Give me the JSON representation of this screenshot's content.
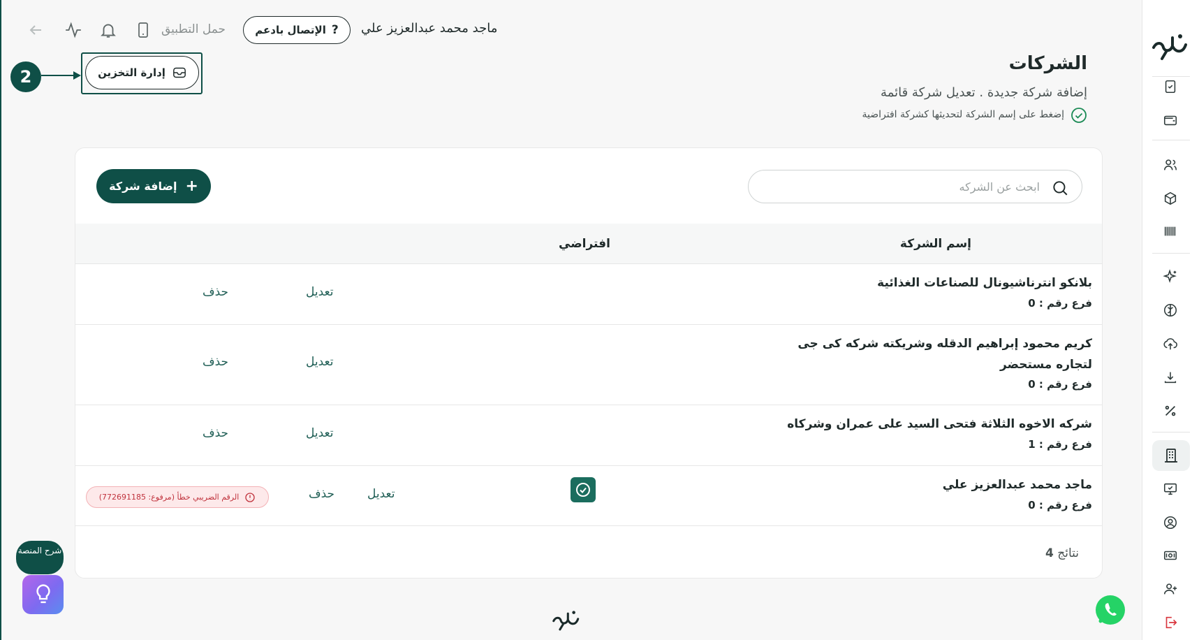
{
  "topbar": {
    "user_name": "ماجد محمد عبدالعزيز علي",
    "support_label": "الإتصال بادعم",
    "support_icon": "?",
    "download_app_label": "حمل التطبيق"
  },
  "storage": {
    "label": "إدارة التخزين",
    "step_number": "2"
  },
  "page": {
    "title": "الشركات",
    "subtitle": "إضافة شركة جديدة . تعديل شركة قائمة",
    "hint": "إضغط على إسم الشركة لتحديثها كشركة افتراضية"
  },
  "search": {
    "placeholder": "ابحث عن الشركه",
    "value": ""
  },
  "add_company": {
    "label": "إضافة شركة",
    "icon": "+"
  },
  "table": {
    "columns": {
      "name": "إسم الشركة",
      "default": "افتراضي"
    },
    "rows": [
      {
        "name": "بلانكو انترناشيونال للصناعات الغذائية",
        "branch": "فرع رقم : 0",
        "edit": "تعديل",
        "delete": "حذف",
        "is_default": false
      },
      {
        "name": "كريم محمود إبراهيم الدقله وشريكته شركه كى جى لتجاره مستحضر",
        "branch": "فرع رقم : 0",
        "edit": "تعديل",
        "delete": "حذف",
        "is_default": false
      },
      {
        "name": "شركه الاخوه الثلاثة فتحى السيد على عمران وشركاه",
        "branch": "فرع رقم : 1",
        "edit": "تعديل",
        "delete": "حذف",
        "is_default": false
      },
      {
        "name": "ماجد محمد عبدالعزيز علي",
        "branch": "فرع رقم : 0",
        "edit": "تعديل",
        "delete": "حذف",
        "is_default": true,
        "error_badge": "الرقم الضريبي خطأ (مرفوع: 772691185)"
      }
    ],
    "results_count": "4",
    "results_label": "نتائج"
  },
  "help": {
    "explain_label": "شرح المنصة"
  },
  "colors": {
    "brand": "#0f4f47",
    "link": "#1f5e55",
    "error": "#c0333d",
    "error_bg": "#fde9ea"
  },
  "sidebar_icons": [
    "brand-logo",
    "clipboard-check-icon",
    "wallet-icon",
    "users-icon",
    "box-icon",
    "barcode-icon",
    "sparkle-icon",
    "brain-icon",
    "cloud-upload-icon",
    "download-icon",
    "percent-icon",
    "building-icon",
    "monitor-icon",
    "user-circle-icon",
    "cash-icon",
    "user-plus-icon",
    "logout-icon"
  ]
}
